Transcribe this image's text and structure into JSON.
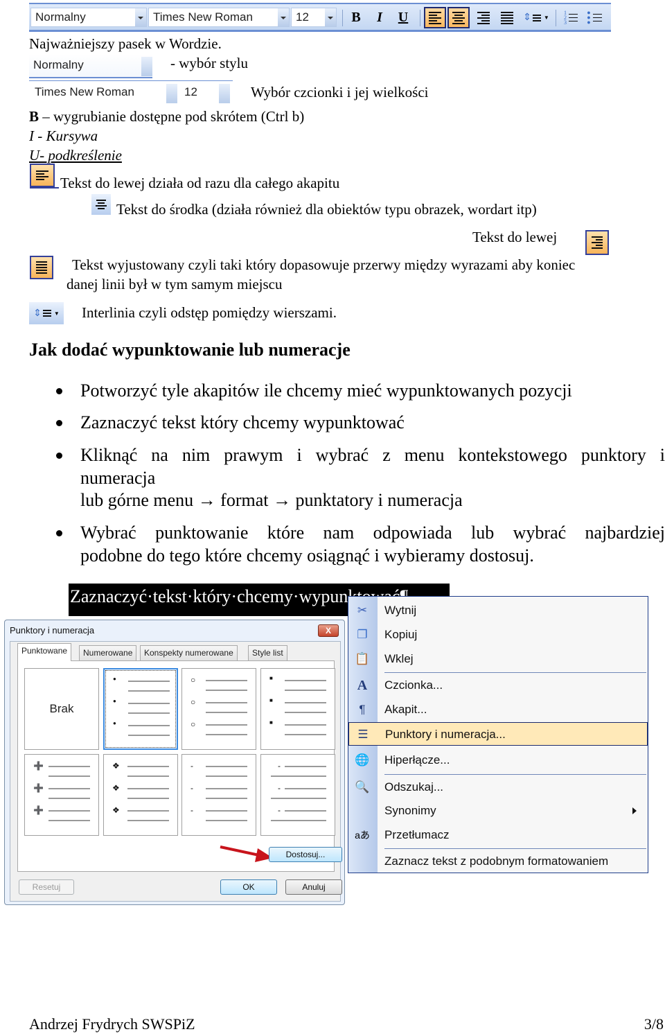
{
  "toolbar": {
    "style_value": "Normalny",
    "font_value": "Times New Roman",
    "size_value": "12",
    "bold_label": "B",
    "italic_label": "I",
    "underline_label": "U",
    "accent_color": "#f9b860",
    "bar_color": "#6b8fd3"
  },
  "intro": {
    "heading": "Najważniejszy pasek w Wordzie.",
    "style_desc": "- wybór stylu",
    "font_desc": "Wybór czcionki i jej wielkości",
    "bold_key": "B",
    "bold_desc": " – wygrubianie dostępne pod skrótem (Ctrl b)",
    "italic_desc": "I - Kursywa",
    "underline_desc": "U- podkreślenie",
    "align_left_desc": "Tekst do lewej działa od razu dla całego akapitu",
    "align_center_desc": "Tekst do środka (działa również dla obiektów typu obrazek, wordart itp)",
    "align_right_desc": "Tekst do lewej",
    "justify_desc_line1": "Tekst wyjustowany czyli taki który dopasowuje przerwy między wyrazami aby koniec",
    "justify_desc_line2": "danej linii był w tym samym miejscu",
    "line_spacing_desc": "Interlinia czyli odstęp pomiędzy wierszami."
  },
  "section": {
    "title": "Jak dodać wypunktowanie lub numeracje",
    "bullets": [
      {
        "lines": [
          "Potworzyć tyle akapitów ile chcemy mieć wypunktowanych pozycji"
        ]
      },
      {
        "lines": [
          "Zaznaczyć tekst który chcemy wypunktować"
        ]
      },
      {
        "lines": [
          "Kliknąć na nim prawym i wybrać z menu kontekstowego punktory i",
          "numeracja",
          "lub górne menu → format → punktatory i numeracja"
        ]
      },
      {
        "lines": [
          "Wybrać punktowanie które nam odpowiada lub wybrać najbardziej",
          "podobne do tego które chcemy osiągnąć i wybieramy dostosuj."
        ]
      }
    ]
  },
  "screenshot": {
    "selected_text": "Zaznaczyć·tekst·który·chcemy·wypunktować¶",
    "dialog": {
      "title": "Punktory i numeracja",
      "close_label": "X",
      "tabs": [
        "Punktowane",
        "Numerowane",
        "Konspekty numerowane",
        "Style list"
      ],
      "active_tab": "Punktowane",
      "none_label": "Brak",
      "bullet_styles": [
        "none",
        "filled-circle",
        "hollow-circle",
        "filled-square",
        "arrow-picture",
        "four-diamond",
        "dash",
        "dash-low"
      ],
      "customize_label": "Dostosuj...",
      "reset_label": "Resetuj",
      "ok_label": "OK",
      "cancel_label": "Anuluj"
    },
    "context_menu": {
      "items": [
        {
          "label": "Wytnij",
          "icon": "scissors-icon"
        },
        {
          "label": "Kopiuj",
          "icon": "copy-icon"
        },
        {
          "label": "Wklej",
          "icon": "paste-icon"
        },
        {
          "label": "Czcionka...",
          "icon": "font-icon"
        },
        {
          "label": "Akapit...",
          "icon": "paragraph-icon"
        },
        {
          "label": "Punktory i numeracja...",
          "icon": "bullets-icon",
          "highlighted": true
        },
        {
          "label": "Hiperłącze...",
          "icon": "hyperlink-icon"
        },
        {
          "label": "Odszukaj...",
          "icon": "research-icon"
        },
        {
          "label": "Synonimy",
          "icon": "",
          "submenu": true
        },
        {
          "label": "Przetłumacz",
          "icon": "translate-icon"
        },
        {
          "label": "Zaznacz tekst z podobnym formatowaniem",
          "icon": ""
        }
      ]
    }
  },
  "footer": {
    "author": "Andrzej Frydrych SWSPiZ",
    "page": "3/8"
  }
}
